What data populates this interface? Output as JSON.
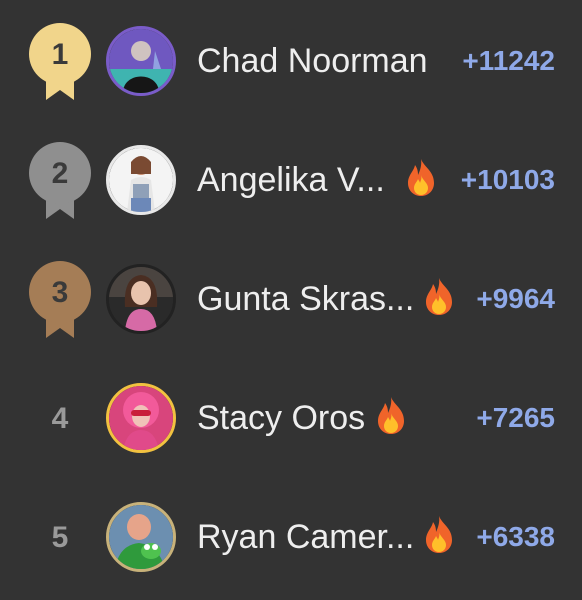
{
  "leaderboard": {
    "entries": [
      {
        "rank": "1",
        "name": "Chad Noorman",
        "points": "+11242",
        "streak": false,
        "medal": "gold"
      },
      {
        "rank": "2",
        "name": "Angelika V...",
        "points": "+10103",
        "streak": true,
        "medal": "silver"
      },
      {
        "rank": "3",
        "name": "Gunta Skras...",
        "points": "+9964",
        "streak": true,
        "medal": "bronze"
      },
      {
        "rank": "4",
        "name": "Stacy Oros",
        "points": "+7265",
        "streak": true,
        "medal": ""
      },
      {
        "rank": "5",
        "name": "Ryan Camer...",
        "points": "+6338",
        "streak": true,
        "medal": ""
      }
    ]
  },
  "colors": {
    "background": "#333333",
    "points": "#8fa9e8",
    "gold": "#f1d58b",
    "silver": "#8f8f8f",
    "bronze": "#a57d56",
    "plain_rank": "#9a9a9a"
  },
  "icons": {
    "medal": "ribbon-medal-icon",
    "streak": "fire-icon"
  }
}
